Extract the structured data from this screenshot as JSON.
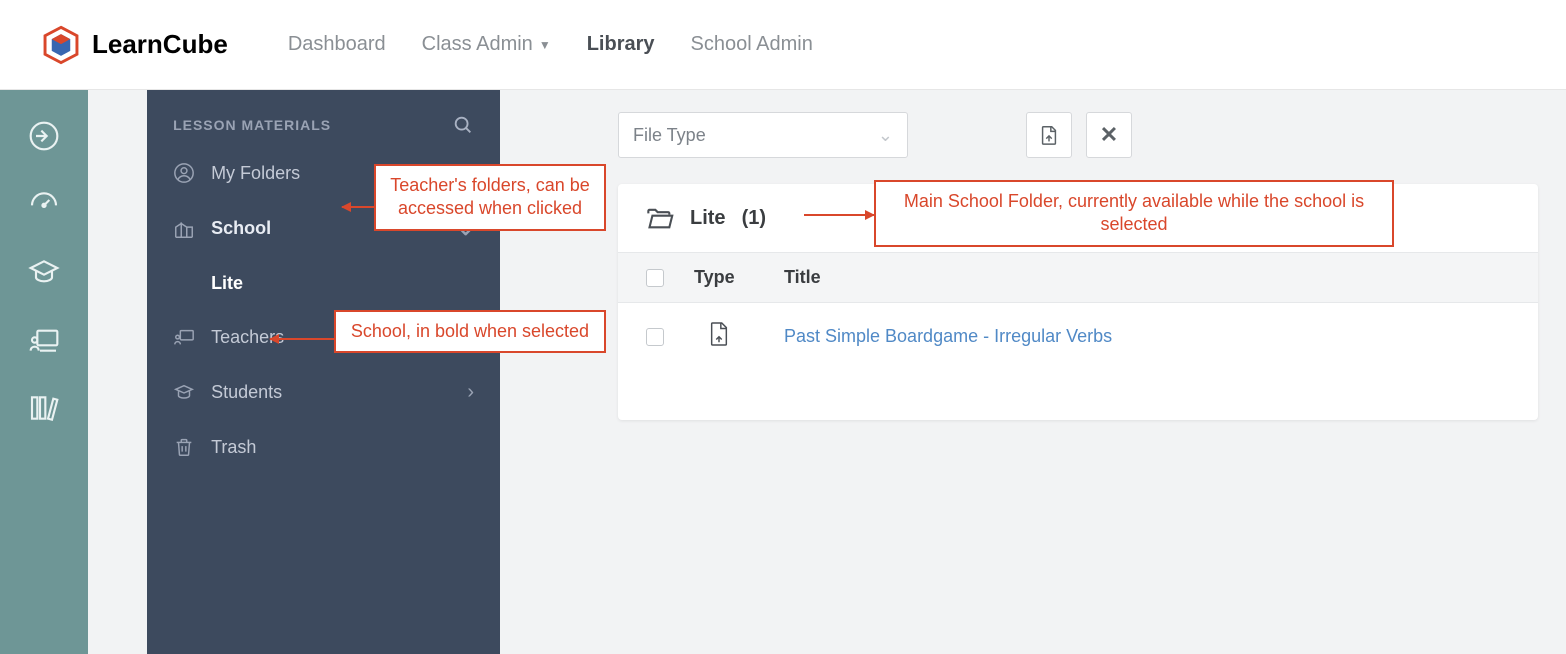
{
  "brand": {
    "name": "LearnCube"
  },
  "topnav": {
    "dashboard": "Dashboard",
    "class_admin": "Class Admin",
    "library": "Library",
    "school_admin": "School Admin"
  },
  "sidebar": {
    "title": "LESSON MATERIALS",
    "my_folders": "My Folders",
    "school": "School",
    "lite": "Lite",
    "teachers": "Teachers",
    "students": "Students",
    "trash": "Trash"
  },
  "filters": {
    "file_type_placeholder": "File Type"
  },
  "breadcrumb": {
    "name": "Lite",
    "count": "(1)"
  },
  "table": {
    "col_type": "Type",
    "col_title": "Title",
    "rows": [
      {
        "title": "Past Simple Boardgame - Irregular Verbs"
      }
    ]
  },
  "annotations": {
    "teachers_folders": "Teacher's folders, can be accessed when clicked",
    "school_selected": "School, in bold when selected",
    "main_folder": "Main School Folder, currently available while the school is selected"
  }
}
